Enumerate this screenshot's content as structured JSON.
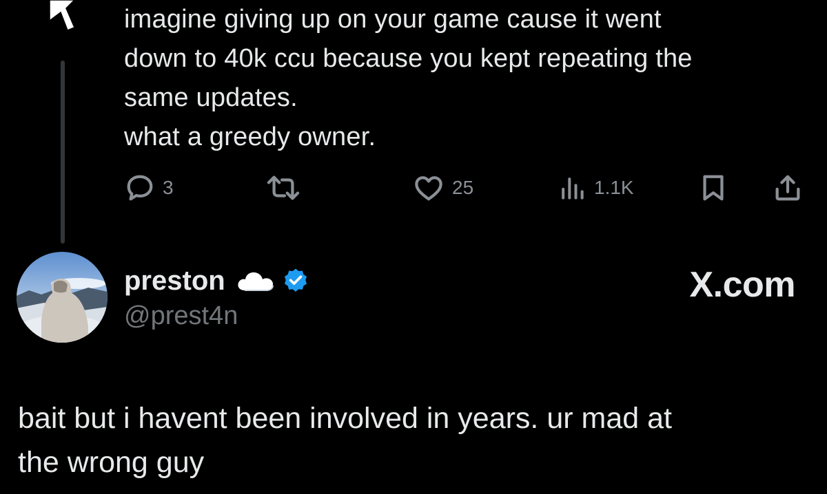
{
  "parent_post": {
    "text_lines": [
      "imagine giving up on your game cause it went",
      "down to 40k ccu because you kept repeating the",
      "same updates.",
      "what a greedy owner."
    ],
    "actions": {
      "reply_count": "3",
      "repost_count": "",
      "like_count": "25",
      "views_count": "1.1K"
    }
  },
  "reply_post": {
    "display_name": "preston",
    "name_emoji": "cloud-icon",
    "verified_badge_color": "#1d9bf0",
    "handle": "@prest4n",
    "brand": "X.com",
    "text_lines": [
      "bait but i havent been involved in years. ur mad at",
      "the wrong guy"
    ]
  },
  "colors": {
    "background": "#000000",
    "text": "#e7e9ea",
    "muted": "#71767b",
    "verified": "#1d9bf0"
  }
}
